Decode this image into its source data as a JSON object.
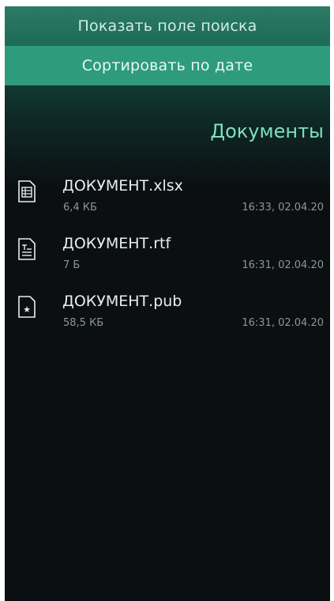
{
  "pulley_menu": {
    "items": [
      {
        "label": "Показать поле поиска"
      },
      {
        "label": "Сортировать по дате"
      }
    ]
  },
  "header": {
    "title": "Документы"
  },
  "files": [
    {
      "name": "ДОКУМЕНТ.xlsx",
      "size": "6,4 КБ",
      "date": "16:33, 02.04.20",
      "icon": "spreadsheet-icon"
    },
    {
      "name": "ДОКУМЕНТ.rtf",
      "size": "7 Б",
      "date": "16:31, 02.04.20",
      "icon": "text-document-icon"
    },
    {
      "name": "ДОКУМЕНТ.pub",
      "size": "58,5 КБ",
      "date": "16:31, 02.04.20",
      "icon": "star-document-icon"
    }
  ],
  "colors": {
    "accent": "#7ee0be",
    "active_menu_bg": "#2e9b7d",
    "background": "#0b0f12"
  }
}
